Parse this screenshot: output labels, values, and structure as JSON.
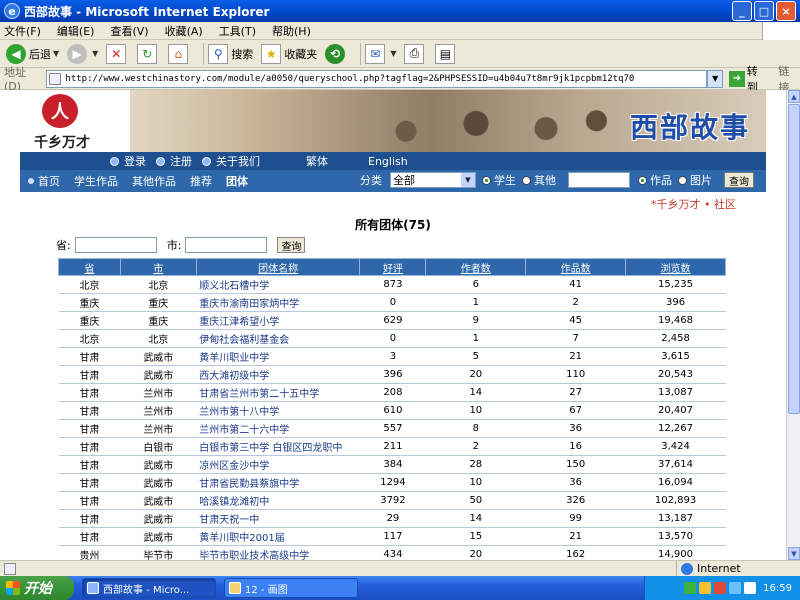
{
  "window": {
    "title": "西部故事 - Microsoft Internet Explorer"
  },
  "menu": [
    "文件(F)",
    "编辑(E)",
    "查看(V)",
    "收藏(A)",
    "工具(T)",
    "帮助(H)"
  ],
  "toolbar": {
    "back": "后退",
    "search": "搜索",
    "favorites": "收藏夹"
  },
  "address": {
    "label": "地址(D)",
    "url": "http://www.westchinastory.com/module/a0050/queryschool.php?tagflag=2&PHPSESSID=u4b04u7t8mr9jk1pcpbm12tq70",
    "go": "转到",
    "links": "链接"
  },
  "site": {
    "logo_text": "千乡万才",
    "logo_mark": "人",
    "title": "西部故事",
    "topnav": [
      "登录",
      "注册",
      "关于我们"
    ],
    "lang": [
      "繁体",
      "English"
    ],
    "subnav": [
      "首页",
      "学生作品",
      "其他作品",
      "推荐",
      "团体"
    ],
    "category_label": "分类",
    "category_value": "全部",
    "radio_student": "学生",
    "radio_other": "其他",
    "radio_works": "作品",
    "radio_image": "图片",
    "search_button": "查询",
    "community": "*千乡万才 • 社区"
  },
  "listing": {
    "heading": "所有团体(75)",
    "province_label": "省:",
    "city_label": "市:",
    "query_button": "查询",
    "columns": [
      "省",
      "市",
      "团体名称",
      "好评",
      "作者数",
      "作品数",
      "浏览数"
    ],
    "rows": [
      [
        "北京",
        "北京",
        "顺义北石槽中学",
        "873",
        "6",
        "41",
        "15,235"
      ],
      [
        "重庆",
        "重庆",
        "重庆市渝南田家炳中学",
        "0",
        "1",
        "2",
        "396"
      ],
      [
        "重庆",
        "重庆",
        "重庆江津希望小学",
        "629",
        "9",
        "45",
        "19,468"
      ],
      [
        "北京",
        "北京",
        "伊甸社会福利基金会",
        "0",
        "1",
        "7",
        "2,458"
      ],
      [
        "甘肃",
        "武威市",
        "黄羊川职业中学",
        "3",
        "5",
        "21",
        "3,615"
      ],
      [
        "甘肃",
        "武威市",
        "西大滩初级中学",
        "396",
        "20",
        "110",
        "20,543"
      ],
      [
        "甘肃",
        "兰州市",
        "甘肃省兰州市第二十五中学",
        "208",
        "14",
        "27",
        "13,087"
      ],
      [
        "甘肃",
        "兰州市",
        "兰州市第十八中学",
        "610",
        "10",
        "67",
        "20,407"
      ],
      [
        "甘肃",
        "兰州市",
        "兰州市第二十六中学",
        "557",
        "8",
        "36",
        "12,267"
      ],
      [
        "甘肃",
        "白银市",
        "白银市第三中学 白银区四龙职中",
        "211",
        "2",
        "16",
        "3,424"
      ],
      [
        "甘肃",
        "武威市",
        "凉州区金沙中学",
        "384",
        "28",
        "150",
        "37,614"
      ],
      [
        "甘肃",
        "武威市",
        "甘肃省民勤县蔡旗中学",
        "1294",
        "10",
        "36",
        "16,094"
      ],
      [
        "甘肃",
        "武威市",
        "哈溪镇龙滩初中",
        "3792",
        "50",
        "326",
        "102,893"
      ],
      [
        "甘肃",
        "武威市",
        "甘肃天祝一中",
        "29",
        "14",
        "99",
        "13,187"
      ],
      [
        "甘肃",
        "武威市",
        "黄羊川职中2001届",
        "117",
        "15",
        "21",
        "13,570"
      ],
      [
        "贵州",
        "毕节市",
        "毕节市职业技术高级中学",
        "434",
        "20",
        "162",
        "14,900"
      ]
    ]
  },
  "status": {
    "zone": "Internet"
  },
  "taskbar": {
    "start": "开始",
    "tasks": [
      "西部故事 - Micro...",
      "12 - 画图"
    ],
    "clock": "16:59"
  }
}
